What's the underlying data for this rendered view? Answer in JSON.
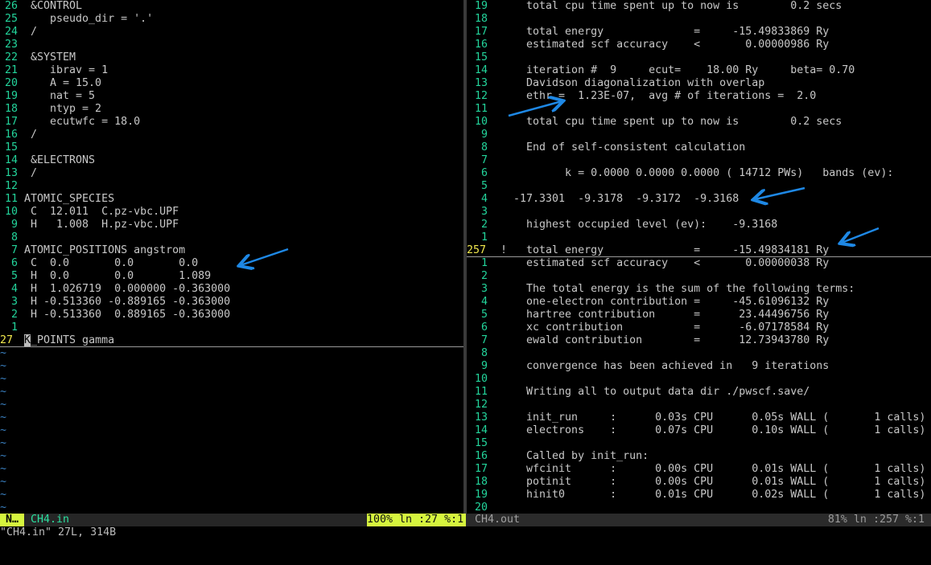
{
  "colors": {
    "line_number": "#23d49b",
    "current_line_number": "#f2e94e",
    "status_accent": "#d6f53e",
    "annotation_arrow": "#1e88e5"
  },
  "left_pane": {
    "lines": [
      [
        "26",
        " &CONTROL"
      ],
      [
        "25",
        "    pseudo_dir = '.'"
      ],
      [
        "24",
        " /"
      ],
      [
        "23",
        ""
      ],
      [
        "22",
        " &SYSTEM"
      ],
      [
        "21",
        "    ibrav = 1"
      ],
      [
        "20",
        "    A = 15.0"
      ],
      [
        "19",
        "    nat = 5"
      ],
      [
        "18",
        "    ntyp = 2"
      ],
      [
        "17",
        "    ecutwfc = 18.0"
      ],
      [
        "16",
        " /"
      ],
      [
        "15",
        ""
      ],
      [
        "14",
        " &ELECTRONS"
      ],
      [
        "13",
        " /"
      ],
      [
        "12",
        ""
      ],
      [
        "11",
        "ATOMIC_SPECIES"
      ],
      [
        "10",
        " C  12.011  C.pz-vbc.UPF"
      ],
      [
        "9",
        " H   1.008  H.pz-vbc.UPF"
      ],
      [
        "8",
        ""
      ],
      [
        "7",
        "ATOMIC_POSITIONS angstrom"
      ],
      [
        "6",
        " C  0.0       0.0       0.0"
      ],
      [
        "5",
        " H  0.0       0.0       1.089"
      ],
      [
        "4",
        " H  1.026719  0.000000 -0.363000"
      ],
      [
        "3",
        " H -0.513360 -0.889165 -0.363000"
      ],
      [
        "2",
        " H -0.513360  0.889165 -0.363000"
      ],
      [
        "1",
        ""
      ]
    ],
    "current_line": {
      "number": "27",
      "cursor_char": "K",
      "rest": "_POINTS gamma"
    },
    "empty_marker": "~"
  },
  "right_pane": {
    "lines": [
      [
        "19",
        "    total cpu time spent up to now is        0.2 secs"
      ],
      [
        "18",
        ""
      ],
      [
        "17",
        "    total energy              =     -15.49833869 Ry"
      ],
      [
        "16",
        "    estimated scf accuracy    <       0.00000986 Ry"
      ],
      [
        "15",
        ""
      ],
      [
        "14",
        "    iteration #  9     ecut=    18.00 Ry     beta= 0.70"
      ],
      [
        "13",
        "    Davidson diagonalization with overlap"
      ],
      [
        "12",
        "    ethr =  1.23E-07,  avg # of iterations =  2.0"
      ],
      [
        "11",
        ""
      ],
      [
        "10",
        "    total cpu time spent up to now is        0.2 secs"
      ],
      [
        "9",
        ""
      ],
      [
        "8",
        "    End of self-consistent calculation"
      ],
      [
        "7",
        ""
      ],
      [
        "6",
        "          k = 0.0000 0.0000 0.0000 ( 14712 PWs)   bands (ev):"
      ],
      [
        "5",
        ""
      ],
      [
        "4",
        "  -17.3301  -9.3178  -9.3172  -9.3168"
      ],
      [
        "3",
        ""
      ],
      [
        "2",
        "    highest occupied level (ev):    -9.3168"
      ],
      [
        "1",
        ""
      ],
      [
        "257",
        "!   total energy              =     -15.49834181 Ry"
      ],
      [
        "1",
        "    estimated scf accuracy    <       0.00000038 Ry"
      ],
      [
        "2",
        ""
      ],
      [
        "3",
        "    The total energy is the sum of the following terms:"
      ],
      [
        "4",
        "    one-electron contribution =     -45.61096132 Ry"
      ],
      [
        "5",
        "    hartree contribution      =      23.44496756 Ry"
      ],
      [
        "6",
        "    xc contribution           =      -6.07178584 Ry"
      ],
      [
        "7",
        "    ewald contribution        =      12.73943780 Ry"
      ],
      [
        "8",
        ""
      ],
      [
        "9",
        "    convergence has been achieved in   9 iterations"
      ],
      [
        "10",
        ""
      ],
      [
        "11",
        "    Writing all to output data dir ./pwscf.save/"
      ],
      [
        "12",
        ""
      ],
      [
        "13",
        "    init_run     :      0.03s CPU      0.05s WALL (       1 calls)"
      ],
      [
        "14",
        "    electrons    :      0.07s CPU      0.10s WALL (       1 calls)"
      ],
      [
        "15",
        ""
      ],
      [
        "16",
        "    Called by init_run:"
      ],
      [
        "17",
        "    wfcinit      :      0.00s CPU      0.01s WALL (       1 calls)"
      ],
      [
        "18",
        "    potinit      :      0.00s CPU      0.01s WALL (       1 calls)"
      ],
      [
        "19",
        "    hinit0       :      0.01s CPU      0.02s WALL (       1 calls)"
      ],
      [
        "20",
        ""
      ]
    ],
    "current_row_index": 19
  },
  "status_left": {
    "mode": "N…",
    "filename": "CH4.in",
    "position": "100% ln :27 %:1"
  },
  "status_right": {
    "filename": "CH4.out",
    "position": "81% ln :257 %:1"
  },
  "command_line": "\"CH4.in\" 27L, 314B"
}
